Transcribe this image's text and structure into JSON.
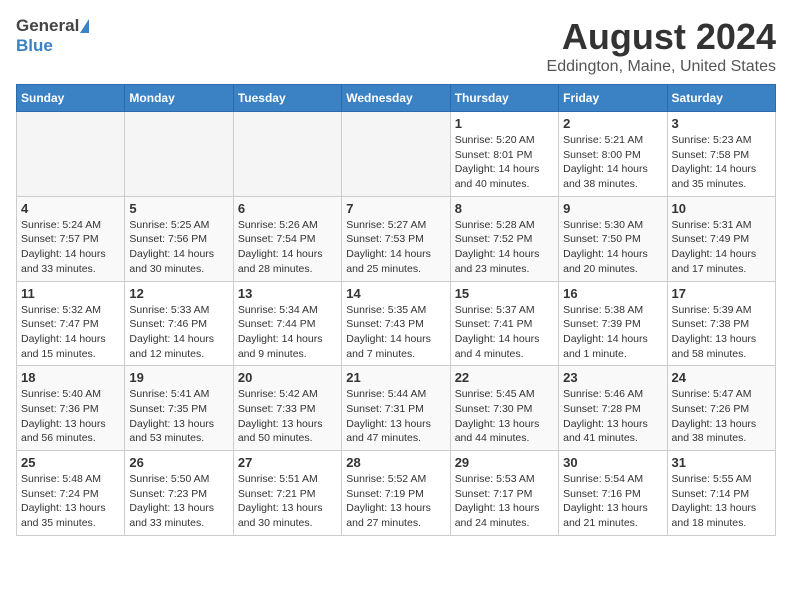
{
  "header": {
    "logo_general": "General",
    "logo_blue": "Blue",
    "title": "August 2024",
    "subtitle": "Eddington, Maine, United States"
  },
  "weekdays": [
    "Sunday",
    "Monday",
    "Tuesday",
    "Wednesday",
    "Thursday",
    "Friday",
    "Saturday"
  ],
  "weeks": [
    [
      {
        "day": "",
        "info": ""
      },
      {
        "day": "",
        "info": ""
      },
      {
        "day": "",
        "info": ""
      },
      {
        "day": "",
        "info": ""
      },
      {
        "day": "1",
        "info": "Sunrise: 5:20 AM\nSunset: 8:01 PM\nDaylight: 14 hours\nand 40 minutes."
      },
      {
        "day": "2",
        "info": "Sunrise: 5:21 AM\nSunset: 8:00 PM\nDaylight: 14 hours\nand 38 minutes."
      },
      {
        "day": "3",
        "info": "Sunrise: 5:23 AM\nSunset: 7:58 PM\nDaylight: 14 hours\nand 35 minutes."
      }
    ],
    [
      {
        "day": "4",
        "info": "Sunrise: 5:24 AM\nSunset: 7:57 PM\nDaylight: 14 hours\nand 33 minutes."
      },
      {
        "day": "5",
        "info": "Sunrise: 5:25 AM\nSunset: 7:56 PM\nDaylight: 14 hours\nand 30 minutes."
      },
      {
        "day": "6",
        "info": "Sunrise: 5:26 AM\nSunset: 7:54 PM\nDaylight: 14 hours\nand 28 minutes."
      },
      {
        "day": "7",
        "info": "Sunrise: 5:27 AM\nSunset: 7:53 PM\nDaylight: 14 hours\nand 25 minutes."
      },
      {
        "day": "8",
        "info": "Sunrise: 5:28 AM\nSunset: 7:52 PM\nDaylight: 14 hours\nand 23 minutes."
      },
      {
        "day": "9",
        "info": "Sunrise: 5:30 AM\nSunset: 7:50 PM\nDaylight: 14 hours\nand 20 minutes."
      },
      {
        "day": "10",
        "info": "Sunrise: 5:31 AM\nSunset: 7:49 PM\nDaylight: 14 hours\nand 17 minutes."
      }
    ],
    [
      {
        "day": "11",
        "info": "Sunrise: 5:32 AM\nSunset: 7:47 PM\nDaylight: 14 hours\nand 15 minutes."
      },
      {
        "day": "12",
        "info": "Sunrise: 5:33 AM\nSunset: 7:46 PM\nDaylight: 14 hours\nand 12 minutes."
      },
      {
        "day": "13",
        "info": "Sunrise: 5:34 AM\nSunset: 7:44 PM\nDaylight: 14 hours\nand 9 minutes."
      },
      {
        "day": "14",
        "info": "Sunrise: 5:35 AM\nSunset: 7:43 PM\nDaylight: 14 hours\nand 7 minutes."
      },
      {
        "day": "15",
        "info": "Sunrise: 5:37 AM\nSunset: 7:41 PM\nDaylight: 14 hours\nand 4 minutes."
      },
      {
        "day": "16",
        "info": "Sunrise: 5:38 AM\nSunset: 7:39 PM\nDaylight: 14 hours\nand 1 minute."
      },
      {
        "day": "17",
        "info": "Sunrise: 5:39 AM\nSunset: 7:38 PM\nDaylight: 13 hours\nand 58 minutes."
      }
    ],
    [
      {
        "day": "18",
        "info": "Sunrise: 5:40 AM\nSunset: 7:36 PM\nDaylight: 13 hours\nand 56 minutes."
      },
      {
        "day": "19",
        "info": "Sunrise: 5:41 AM\nSunset: 7:35 PM\nDaylight: 13 hours\nand 53 minutes."
      },
      {
        "day": "20",
        "info": "Sunrise: 5:42 AM\nSunset: 7:33 PM\nDaylight: 13 hours\nand 50 minutes."
      },
      {
        "day": "21",
        "info": "Sunrise: 5:44 AM\nSunset: 7:31 PM\nDaylight: 13 hours\nand 47 minutes."
      },
      {
        "day": "22",
        "info": "Sunrise: 5:45 AM\nSunset: 7:30 PM\nDaylight: 13 hours\nand 44 minutes."
      },
      {
        "day": "23",
        "info": "Sunrise: 5:46 AM\nSunset: 7:28 PM\nDaylight: 13 hours\nand 41 minutes."
      },
      {
        "day": "24",
        "info": "Sunrise: 5:47 AM\nSunset: 7:26 PM\nDaylight: 13 hours\nand 38 minutes."
      }
    ],
    [
      {
        "day": "25",
        "info": "Sunrise: 5:48 AM\nSunset: 7:24 PM\nDaylight: 13 hours\nand 35 minutes."
      },
      {
        "day": "26",
        "info": "Sunrise: 5:50 AM\nSunset: 7:23 PM\nDaylight: 13 hours\nand 33 minutes."
      },
      {
        "day": "27",
        "info": "Sunrise: 5:51 AM\nSunset: 7:21 PM\nDaylight: 13 hours\nand 30 minutes."
      },
      {
        "day": "28",
        "info": "Sunrise: 5:52 AM\nSunset: 7:19 PM\nDaylight: 13 hours\nand 27 minutes."
      },
      {
        "day": "29",
        "info": "Sunrise: 5:53 AM\nSunset: 7:17 PM\nDaylight: 13 hours\nand 24 minutes."
      },
      {
        "day": "30",
        "info": "Sunrise: 5:54 AM\nSunset: 7:16 PM\nDaylight: 13 hours\nand 21 minutes."
      },
      {
        "day": "31",
        "info": "Sunrise: 5:55 AM\nSunset: 7:14 PM\nDaylight: 13 hours\nand 18 minutes."
      }
    ]
  ]
}
